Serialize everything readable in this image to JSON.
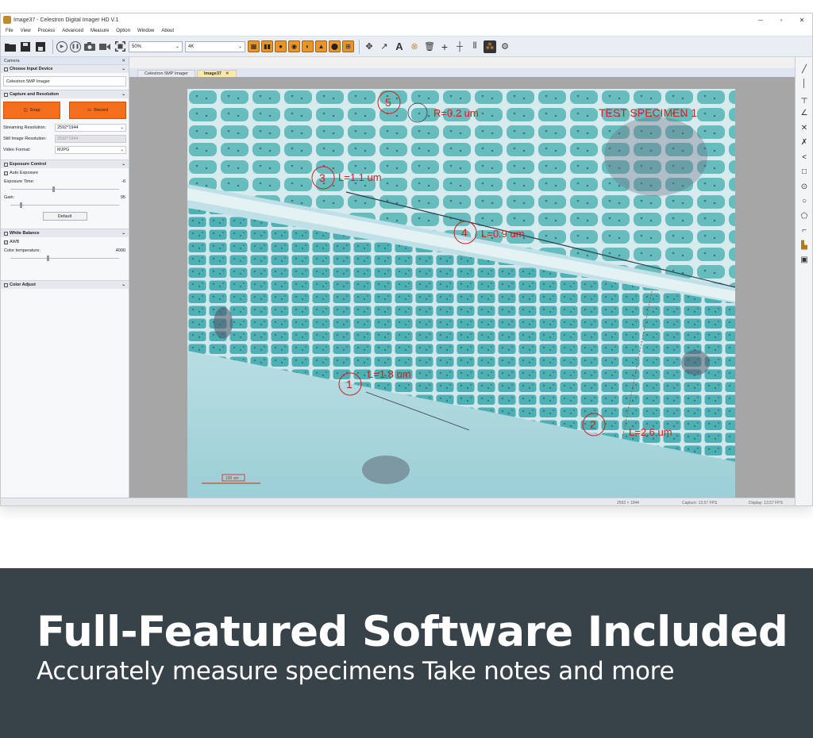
{
  "window": {
    "title": "Image37 - Celestron Digital Imager HD V.1",
    "min": "─",
    "max": "▫",
    "close": "✕"
  },
  "menu": [
    "File",
    "View",
    "Process",
    "Advanced",
    "Measure",
    "Option",
    "Window",
    "About"
  ],
  "toolbar": {
    "zoom_value": "50%",
    "resolution_value": "4K",
    "text_tool": "A"
  },
  "left_panel": {
    "title": "Camera",
    "pin": "✕",
    "sections": {
      "input_device": "Choose Input Device",
      "capture": "Capture and Resolution",
      "exposure": "Exposure Control",
      "white_balance": "White Balance",
      "color_adjust": "Color Adjust"
    },
    "device_name": "Celestron 5MP Imager",
    "snap_label": "Snap",
    "record_label": "Record",
    "streaming_label": "Streaming Resolution:",
    "streaming_value": "2592*1944",
    "still_label": "Still Image Resolution:",
    "still_value": "2592*1944",
    "format_label": "Video Format:",
    "format_value": "MJPG",
    "auto_exposure_label": "Auto Exposure",
    "exposure_time_label": "Exposure Time:",
    "exposure_time_value": "-6",
    "gain_label": "Gain:",
    "gain_value": "95",
    "default_label": "Default",
    "awb_label": "AWB",
    "color_temp_label": "Color temperature:",
    "color_temp_value": "4000",
    "exposure_level": 0.4,
    "gain_level": 0.1,
    "color_temp_level": 0.35,
    "collapse": "⌄"
  },
  "tabs": [
    {
      "label": "Celestron 5MP Imager"
    },
    {
      "label": "Image37",
      "close": "✕"
    }
  ],
  "annotations": {
    "m1": {
      "num": "1",
      "label": "L=1.8 um"
    },
    "m2": {
      "num": "2",
      "label": "L=2.6 um"
    },
    "m3": {
      "num": "3",
      "label": "L=1.1 um"
    },
    "m4": {
      "num": "4",
      "label": "L=0.9 um"
    },
    "m5": {
      "num": "5",
      "label": "R=0.2 um"
    },
    "specimen_title": "TEST SPECIMEN 1",
    "scale_label": "100 um"
  },
  "status": {
    "size": "2592 × 1944",
    "capture": "Capture: 13.57 FPS",
    "display": "Display: 13.57 FPS"
  },
  "banner": {
    "headline": "Full-Featured Software Included",
    "subline": "Accurately measure specimens Take notes and more"
  },
  "colors": {
    "accent_orange": "#f36f1d",
    "annotation_red": "#d32020",
    "banner_bg": "#384249",
    "specimen_teal": "#5fb4b4"
  }
}
